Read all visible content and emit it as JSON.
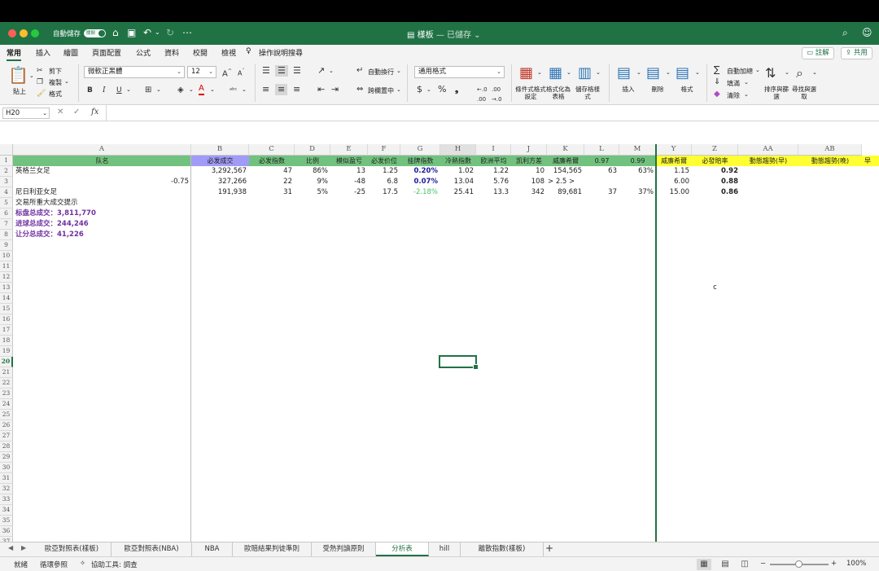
{
  "window": {
    "autosave_label": "自動儲存",
    "autosave_state": "關閉",
    "doc_name": "樣板",
    "doc_status": " — 已儲存"
  },
  "ribbon_tabs": [
    "常用",
    "插入",
    "繪圖",
    "頁面配置",
    "公式",
    "資料",
    "校閱",
    "檢視",
    "操作說明搜尋"
  ],
  "ribbon_right": {
    "comment": "註解",
    "share": "共用"
  },
  "ribbon": {
    "paste": "貼上",
    "cut": "剪下",
    "copy": "複製",
    "format_painter": "格式",
    "font_name": "微軟正黑體",
    "font_size": "12",
    "bold": "B",
    "italic": "I",
    "underline": "U",
    "wrap_text": "自動換行",
    "merge_center": "跨欄置中",
    "number_format": "通用格式",
    "conditional_format": "條件式格式設定",
    "format_as_table": "格式化為表格",
    "cell_styles": "儲存格樣式",
    "insert": "插入",
    "delete": "刪除",
    "format": "格式",
    "autosum": "自動加總",
    "fill": "填滿",
    "clear": "清除",
    "sort_filter": "排序與篩選",
    "find_select": "尋找與選取"
  },
  "formula": {
    "name_box": "H20",
    "fx": "fx"
  },
  "columns": [
    "A",
    "B",
    "C",
    "D",
    "E",
    "F",
    "G",
    "H",
    "I",
    "J",
    "K",
    "L",
    "M",
    "Y",
    "Z",
    "AA",
    "AB"
  ],
  "rows": [
    "1",
    "2",
    "3",
    "4",
    "5",
    "6",
    "7",
    "8",
    "9",
    "10",
    "11",
    "12",
    "13",
    "14",
    "15",
    "16",
    "17",
    "18",
    "19",
    "20",
    "21",
    "22",
    "23",
    "24",
    "25",
    "26",
    "27",
    "28",
    "29",
    "30",
    "31",
    "32",
    "33",
    "34",
    "35",
    "36",
    "37"
  ],
  "header_row": [
    "队名",
    "必发成交",
    "必发指数",
    "比例",
    "模似盈亏",
    "必发价位",
    "挂牌指数",
    "冷熱指數",
    "欧洲平均",
    "凯利方差",
    "威廉希爾",
    "0.97",
    "0.99",
    "威廉希爾",
    "必發賠率",
    "動態趨勢(早)",
    "動態趨勢(晚)"
  ],
  "header_extra": "早",
  "data": {
    "r2": {
      "a": "英格兰女足",
      "b": "3,292,567",
      "c": "47",
      "d": "86%",
      "e": "13",
      "f": "1.25",
      "g": "0.20%",
      "h": "1.02",
      "i": "1.22",
      "j": "10",
      "k": "154,565",
      "l": "63",
      "m": "63%",
      "y": "1.15",
      "z": "0.92"
    },
    "r3": {
      "a": "-0.75",
      "b": "327,266",
      "c": "22",
      "d": "9%",
      "e": "-48",
      "f": "6.8",
      "g": "0.07%",
      "h": "13.04",
      "i": "5.76",
      "j": "108",
      "j2": "> 2.5 >",
      "y": "6.00",
      "z": "0.88"
    },
    "r4": {
      "a": "尼日利亚女足",
      "b": "191,938",
      "c": "31",
      "d": "5%",
      "e": "-25",
      "f": "17.5",
      "g": "-2.18%",
      "h": "25.41",
      "i": "13.3",
      "j": "342",
      "k": "89,681",
      "l": "37",
      "m": "37%",
      "y": "15.00",
      "z": "0.86"
    },
    "r5": {
      "a": "交易所重大成交提示"
    },
    "r6": {
      "a": "标盘总成交：3,811,770"
    },
    "r7": {
      "a": "进球总成交：244,246"
    },
    "r8": {
      "a": "让分总成交：41,226"
    },
    "z13": "c"
  },
  "sheet_tabs": [
    "歐亞對照表(樣板)",
    "歐亞對照表(NBA)",
    "NBA",
    "歐賠結果判徒準則",
    "受熱判讀原則",
    "分析表",
    "hill",
    "離散指數(樣板)"
  ],
  "active_sheet": "分析表",
  "status": {
    "ready": "就緒",
    "circular": "循環參照",
    "accessibility": "協助工具: 調查",
    "zoom": "100%"
  }
}
